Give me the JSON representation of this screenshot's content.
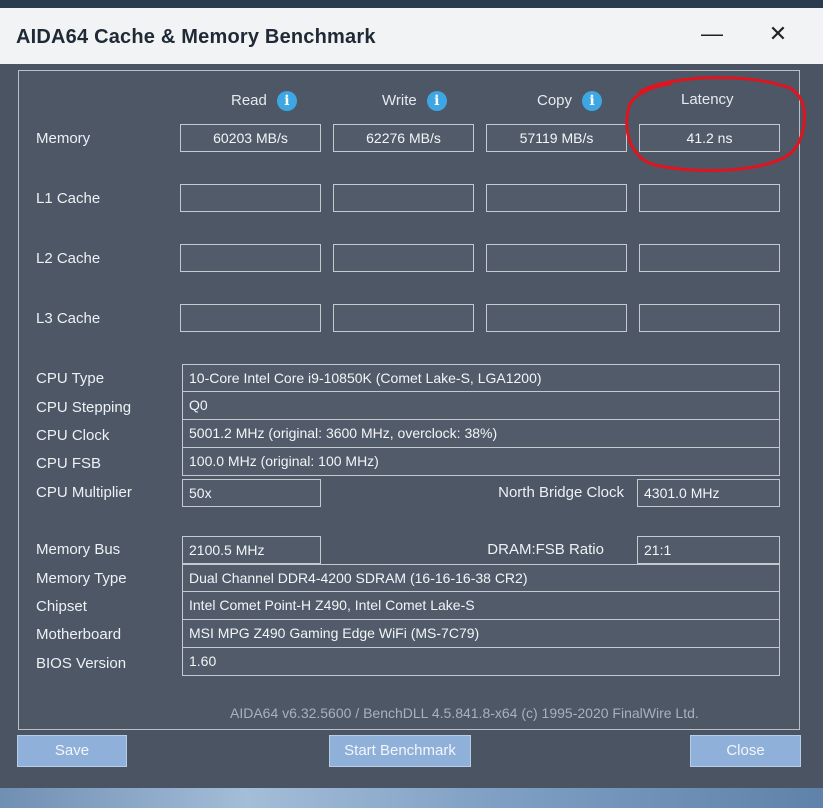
{
  "window": {
    "title": "AIDA64 Cache & Memory Benchmark",
    "minimize_glyph": "—",
    "close_glyph": "✕"
  },
  "headers": {
    "read": "Read",
    "write": "Write",
    "copy": "Copy",
    "latency": "Latency",
    "info_glyph": "i"
  },
  "rows": {
    "memory": {
      "label": "Memory",
      "read": "60203 MB/s",
      "write": "62276 MB/s",
      "copy": "57119 MB/s",
      "latency": "41.2 ns"
    },
    "l1": {
      "label": "L1 Cache",
      "read": "",
      "write": "",
      "copy": "",
      "latency": ""
    },
    "l2": {
      "label": "L2 Cache",
      "read": "",
      "write": "",
      "copy": "",
      "latency": ""
    },
    "l3": {
      "label": "L3 Cache",
      "read": "",
      "write": "",
      "copy": "",
      "latency": ""
    }
  },
  "cpu": {
    "type_label": "CPU Type",
    "type": "10-Core Intel Core i9-10850K  (Comet Lake-S, LGA1200)",
    "stepping_label": "CPU Stepping",
    "stepping": "Q0",
    "clock_label": "CPU Clock",
    "clock": "5001.2 MHz  (original: 3600 MHz, overclock: 38%)",
    "fsb_label": "CPU FSB",
    "fsb": "100.0 MHz  (original: 100 MHz)",
    "multiplier_label": "CPU Multiplier",
    "multiplier": "50x",
    "nb_clock_label": "North Bridge Clock",
    "nb_clock": "4301.0 MHz"
  },
  "memory_info": {
    "bus_label": "Memory Bus",
    "bus": "2100.5 MHz",
    "ratio_label": "DRAM:FSB Ratio",
    "ratio": "21:1",
    "type_label": "Memory Type",
    "type": "Dual Channel DDR4-4200 SDRAM  (16-16-16-38 CR2)",
    "chipset_label": "Chipset",
    "chipset": "Intel Comet Point-H Z490, Intel Comet Lake-S",
    "motherboard_label": "Motherboard",
    "motherboard": "MSI MPG Z490 Gaming Edge WiFi (MS-7C79)",
    "bios_label": "BIOS Version",
    "bios": "1.60"
  },
  "footer": {
    "version": "AIDA64 v6.32.5600 / BenchDLL 4.5.841.8-x64  (c) 1995-2020 FinalWire Ltd."
  },
  "buttons": {
    "save": "Save",
    "start": "Start Benchmark",
    "close": "Close"
  },
  "colors": {
    "window_bg": "#4a5462",
    "button_bg": "#8fb0d8",
    "annotation_red": "#e0141e",
    "info_blue": "#3da6e3"
  }
}
